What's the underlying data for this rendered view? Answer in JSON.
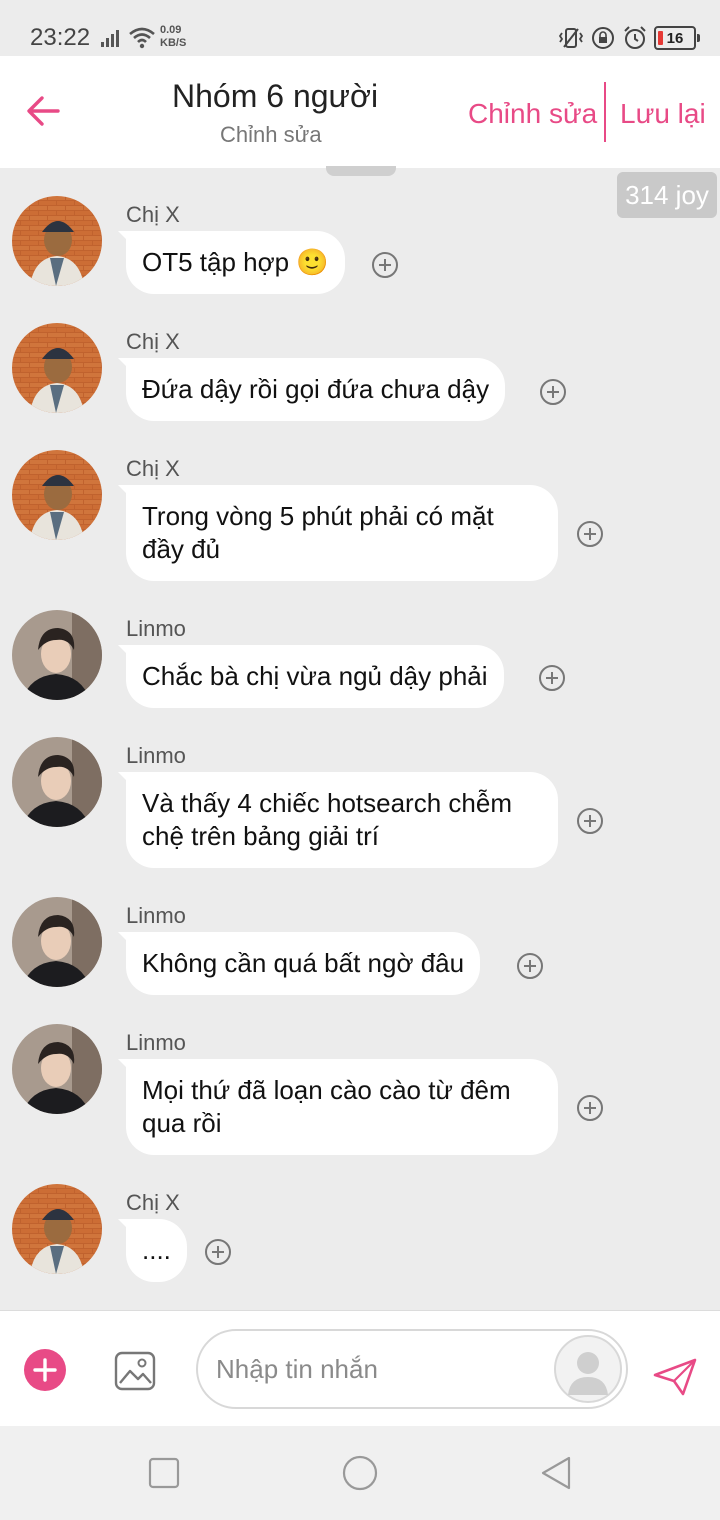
{
  "status_bar": {
    "time": "23:22",
    "net_speed_value": "0.09",
    "net_speed_unit": "KB/S",
    "battery": "16",
    "icons": [
      "signal-icon",
      "wifi-icon",
      "vibrate-icon",
      "rotation-lock-icon",
      "alarm-icon",
      "battery-icon"
    ]
  },
  "header": {
    "title": "Nhóm 6 người",
    "subtitle": "Chỉnh sửa",
    "edit_label": "Chỉnh sửa",
    "save_label": "Lưu lại",
    "accent_color": "#e84a86"
  },
  "joy_badge": "314 joy",
  "messages": [
    {
      "sender": "Chị X",
      "text": "OT5 tập hợp 🙂",
      "avatar": "avatar-chi-x"
    },
    {
      "sender": "Chị X",
      "text": "Đứa dậy rồi gọi đứa chưa dậy",
      "avatar": "avatar-chi-x"
    },
    {
      "sender": "Chị X",
      "text": "Trong vòng 5 phút phải có mặt đầy đủ",
      "avatar": "avatar-chi-x"
    },
    {
      "sender": "Linmo",
      "text": "Chắc bà chị vừa ngủ dậy phải",
      "avatar": "avatar-linmo"
    },
    {
      "sender": "Linmo",
      "text": "Và thấy 4 chiếc hotsearch chễm chệ trên bảng giải trí",
      "avatar": "avatar-linmo"
    },
    {
      "sender": "Linmo",
      "text": "Không cần quá bất ngờ đâu",
      "avatar": "avatar-linmo"
    },
    {
      "sender": "Linmo",
      "text": "Mọi thứ đã loạn cào cào từ đêm qua rồi",
      "avatar": "avatar-linmo"
    },
    {
      "sender": "Chị X",
      "text": "....",
      "avatar": "avatar-chi-x"
    }
  ],
  "composer": {
    "placeholder": "Nhập tin nhắn",
    "value": ""
  }
}
